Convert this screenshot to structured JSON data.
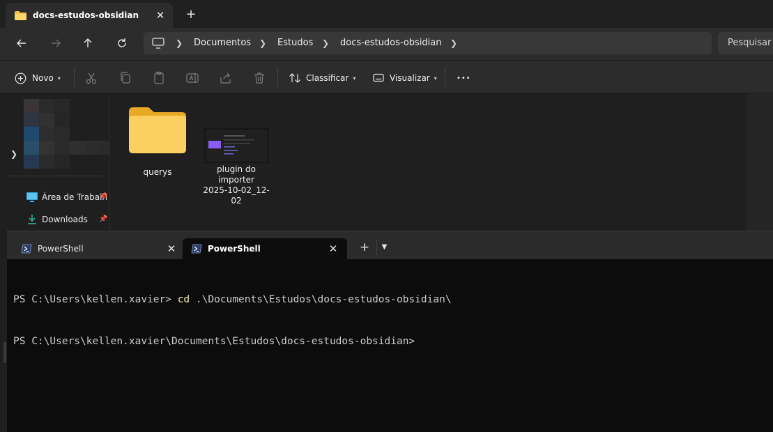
{
  "explorer": {
    "tab_title": "docs-estudos-obsidian",
    "close_glyph": "✕",
    "new_tab_glyph": "+",
    "breadcrumbs": [
      "Documentos",
      "Estudos",
      "docs-estudos-obsidian"
    ],
    "search_placeholder": "Pesquisar",
    "commands": {
      "new": "Novo",
      "sort": "Classificar",
      "view": "Visualizar",
      "more": "•••"
    },
    "nav_pane": {
      "quick_access": [
        {
          "label": "Área de Trabalh",
          "icon": "desktop-icon",
          "pinned": true
        },
        {
          "label": "Downloads",
          "icon": "download-icon",
          "pinned": true
        }
      ]
    },
    "items": [
      {
        "name": "querys",
        "type": "folder"
      },
      {
        "name": "plugin do importer 2025-10-02_12-02",
        "line1": "plugin do",
        "line2": "importer",
        "line3": "2025-10-02_12-02",
        "type": "image"
      }
    ],
    "accent_folder": "#f6c34b"
  },
  "terminal": {
    "tabs": [
      {
        "label": "PowerShell",
        "active": false
      },
      {
        "label": "PowerShell",
        "active": true
      }
    ],
    "lines": [
      {
        "prompt": "PS C:\\Users\\kellen.xavier> ",
        "cmd": "cd",
        "args": " .\\Documents\\Estudos\\docs-estudos-obsidian\\"
      },
      {
        "prompt": "PS C:\\Users\\kellen.xavier\\Documents\\Estudos\\docs-estudos-obsidian>",
        "cmd": "",
        "args": ""
      }
    ]
  }
}
